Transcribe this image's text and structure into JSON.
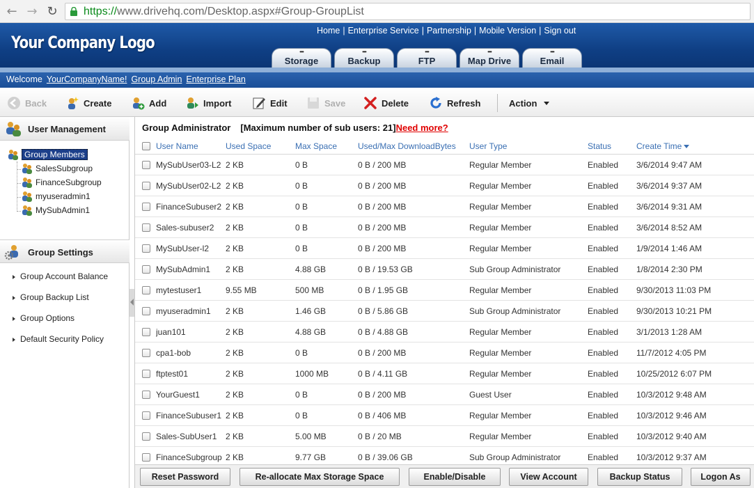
{
  "browser": {
    "url_scheme": "https://",
    "url_rest": "www.drivehq.com/Desktop.aspx#Group-GroupList"
  },
  "header": {
    "logo": "Your Company Logo",
    "top_links": [
      "Home",
      "Enterprise Service",
      "Partnership",
      "Mobile Version",
      "Sign out"
    ],
    "tabs": [
      "Storage",
      "Backup",
      "FTP",
      "Map Drive",
      "Email"
    ]
  },
  "welcome": {
    "label": "Welcome",
    "links": [
      "YourCompanyName!",
      "Group Admin",
      "Enterprise Plan"
    ]
  },
  "toolbar": {
    "back": "Back",
    "create": "Create",
    "add": "Add",
    "import": "Import",
    "edit": "Edit",
    "save": "Save",
    "delete": "Delete",
    "refresh": "Refresh",
    "action": "Action"
  },
  "left": {
    "user_management": "User Management",
    "tree_root": "Group Members",
    "tree_children": [
      "SalesSubgroup",
      "FinanceSubgroup",
      "myuseradmin1",
      "MySubAdmin1"
    ],
    "group_settings": "Group Settings",
    "settings_items": [
      "Group Account Balance",
      "Group Backup List",
      "Group Options",
      "Default Security Policy"
    ]
  },
  "main": {
    "title": "Group Administrator",
    "max_users": "[Maximum number of sub users: 21]",
    "need_more": "Need more?",
    "columns": [
      "User Name",
      "Used Space",
      "Max Space",
      "Used/Max DownloadBytes",
      "User Type",
      "Status",
      "Create Time"
    ],
    "rows": [
      [
        "MySubUser03-L2",
        "2 KB",
        "0 B",
        "0 B / 200 MB",
        "Regular Member",
        "Enabled",
        "3/6/2014 9:47 AM"
      ],
      [
        "MySubUser02-L2",
        "2 KB",
        "0 B",
        "0 B / 200 MB",
        "Regular Member",
        "Enabled",
        "3/6/2014 9:37 AM"
      ],
      [
        "FinanceSubuser2",
        "2 KB",
        "0 B",
        "0 B / 200 MB",
        "Regular Member",
        "Enabled",
        "3/6/2014 9:31 AM"
      ],
      [
        "Sales-subuser2",
        "2 KB",
        "0 B",
        "0 B / 200 MB",
        "Regular Member",
        "Enabled",
        "3/6/2014 8:52 AM"
      ],
      [
        "MySubUser-l2",
        "2 KB",
        "0 B",
        "0 B / 200 MB",
        "Regular Member",
        "Enabled",
        "1/9/2014 1:46 AM"
      ],
      [
        "MySubAdmin1",
        "2 KB",
        "4.88 GB",
        "0 B / 19.53 GB",
        "Sub Group Administrator",
        "Enabled",
        "1/8/2014 2:30 PM"
      ],
      [
        "mytestuser1",
        "9.55 MB",
        "500 MB",
        "0 B / 1.95 GB",
        "Regular Member",
        "Enabled",
        "9/30/2013 11:03 PM"
      ],
      [
        "myuseradmin1",
        "2 KB",
        "1.46 GB",
        "0 B / 5.86 GB",
        "Sub Group Administrator",
        "Enabled",
        "9/30/2013 10:21 PM"
      ],
      [
        "juan101",
        "2 KB",
        "4.88 GB",
        "0 B / 4.88 GB",
        "Regular Member",
        "Enabled",
        "3/1/2013 1:28 AM"
      ],
      [
        "cpa1-bob",
        "2 KB",
        "0 B",
        "0 B / 200 MB",
        "Regular Member",
        "Enabled",
        "11/7/2012 4:05 PM"
      ],
      [
        "ftptest01",
        "2 KB",
        "1000 MB",
        "0 B / 4.11 GB",
        "Regular Member",
        "Enabled",
        "10/25/2012 6:07 PM"
      ],
      [
        "YourGuest1",
        "2 KB",
        "0 B",
        "0 B / 200 MB",
        "Guest User",
        "Enabled",
        "10/3/2012 9:48 AM"
      ],
      [
        "FinanceSubuser1",
        "2 KB",
        "0 B",
        "0 B / 406 MB",
        "Regular Member",
        "Enabled",
        "10/3/2012 9:46 AM"
      ],
      [
        "Sales-SubUser1",
        "2 KB",
        "5.00 MB",
        "0 B / 20 MB",
        "Regular Member",
        "Enabled",
        "10/3/2012 9:40 AM"
      ],
      [
        "FinanceSubgroup",
        "2 KB",
        "9.77 GB",
        "0 B / 39.06 GB",
        "Sub Group Administrator",
        "Enabled",
        "10/3/2012 9:37 AM"
      ]
    ]
  },
  "bottom_buttons": [
    "Reset Password",
    "Re-allocate Max Storage Space",
    "Enable/Disable",
    "View Account",
    "Backup Status",
    "Logon As"
  ],
  "colors": {
    "header_blue": "#0f3f84",
    "link_red": "#e00000",
    "column_blue": "#3a6fb3"
  }
}
